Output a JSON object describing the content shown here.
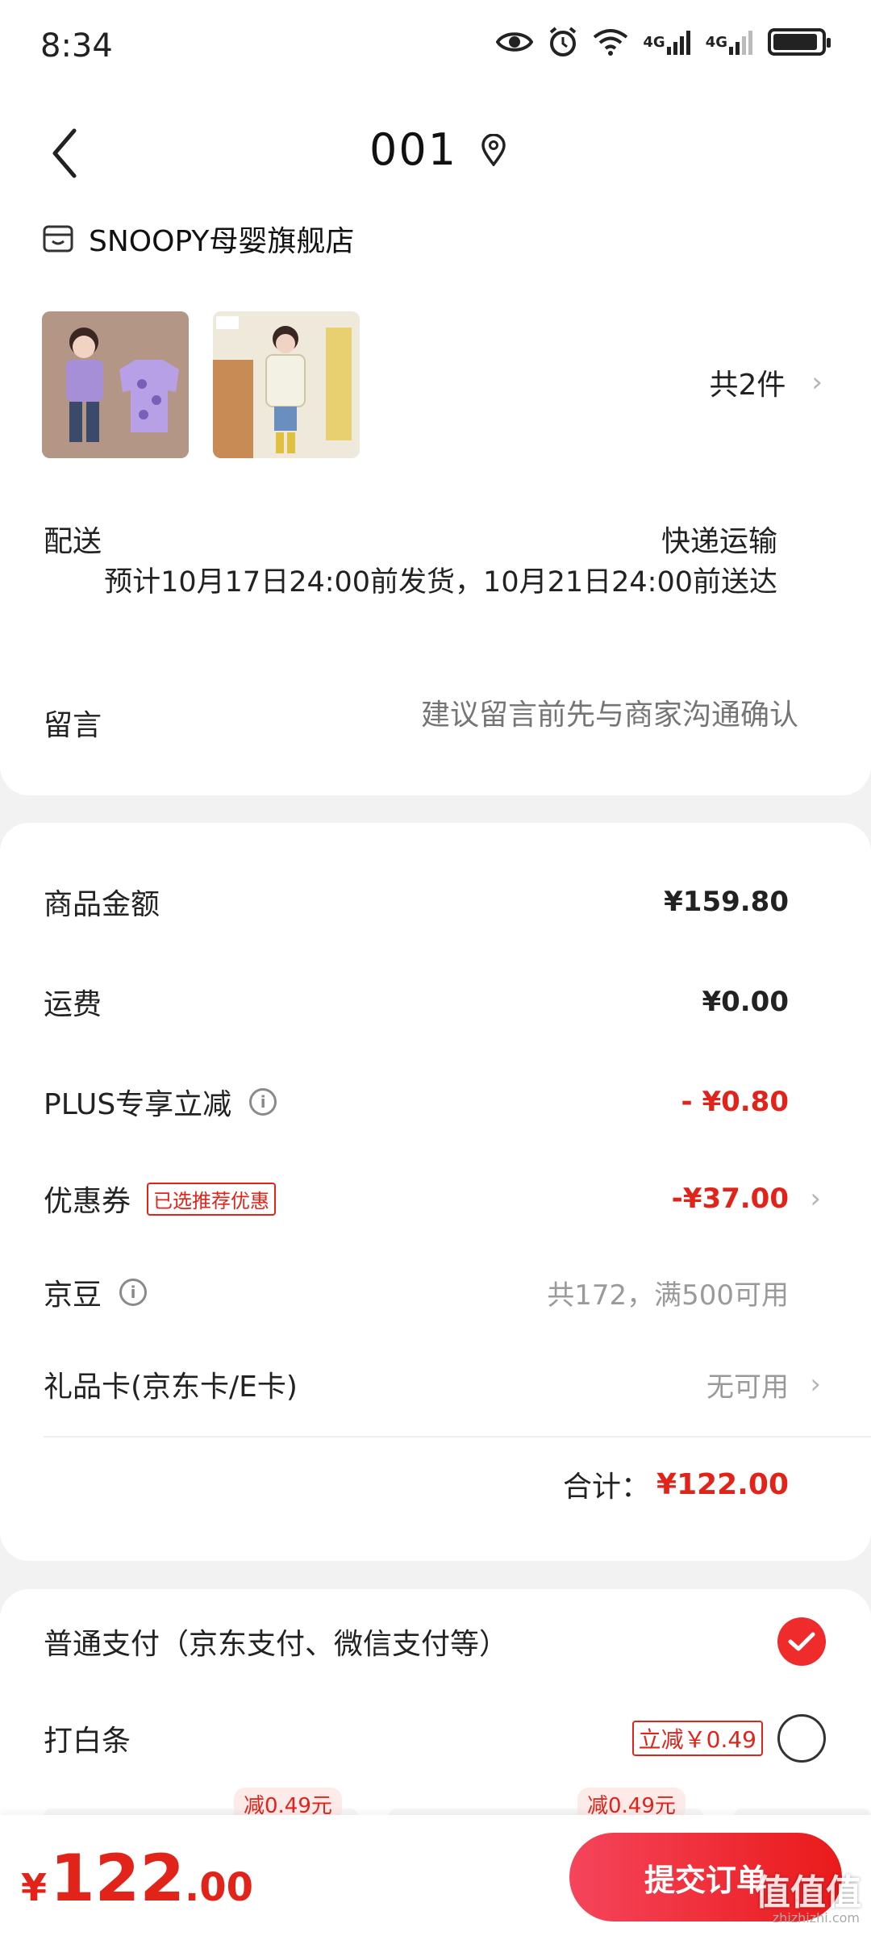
{
  "status_bar": {
    "time": "8:34",
    "network_labels": [
      "4G",
      "4G"
    ]
  },
  "header": {
    "title": "001"
  },
  "store": {
    "name": "SNOOPY母婴旗舰店"
  },
  "products": {
    "count_label": "共2件"
  },
  "delivery": {
    "label": "配送",
    "method": "快递运输",
    "estimate": "预计10月17日24:00前发货，10月21日24:00前送达"
  },
  "note": {
    "label": "留言",
    "placeholder": "建议留言前先与商家沟通确认"
  },
  "summary": {
    "goods_label": "商品金额",
    "goods_value": "¥159.80",
    "shipping_label": "运费",
    "shipping_value": "¥0.00",
    "plus_label": "PLUS专享立减",
    "plus_value": "- ¥0.80",
    "coupon_label": "优惠券",
    "coupon_tag": "已选推荐优惠",
    "coupon_value": "-¥37.00",
    "jingdou_label": "京豆",
    "jingdou_value": "共172，满500可用",
    "giftcard_label": "礼品卡(京东卡/E卡)",
    "giftcard_value": "无可用",
    "total_label": "合计：",
    "total_value": "¥122.00"
  },
  "payment": {
    "normal_label": "普通支付（京东支付、微信支付等）",
    "baitiao_label": "打白条",
    "baitiao_tag": "立减￥0.49",
    "plan_tags": [
      "减0.49元",
      "减0.49元"
    ]
  },
  "bottom": {
    "price_currency": "¥",
    "price_int": "122",
    "price_dec": ".00",
    "submit_label": "提交订单",
    "watermark": "值值值",
    "watermark_sub": "zhizhizhi.com"
  },
  "colors": {
    "accent_red": "#e2231a",
    "button_gradient_start": "#f5455c",
    "button_gradient_end": "#ea1a1a"
  }
}
